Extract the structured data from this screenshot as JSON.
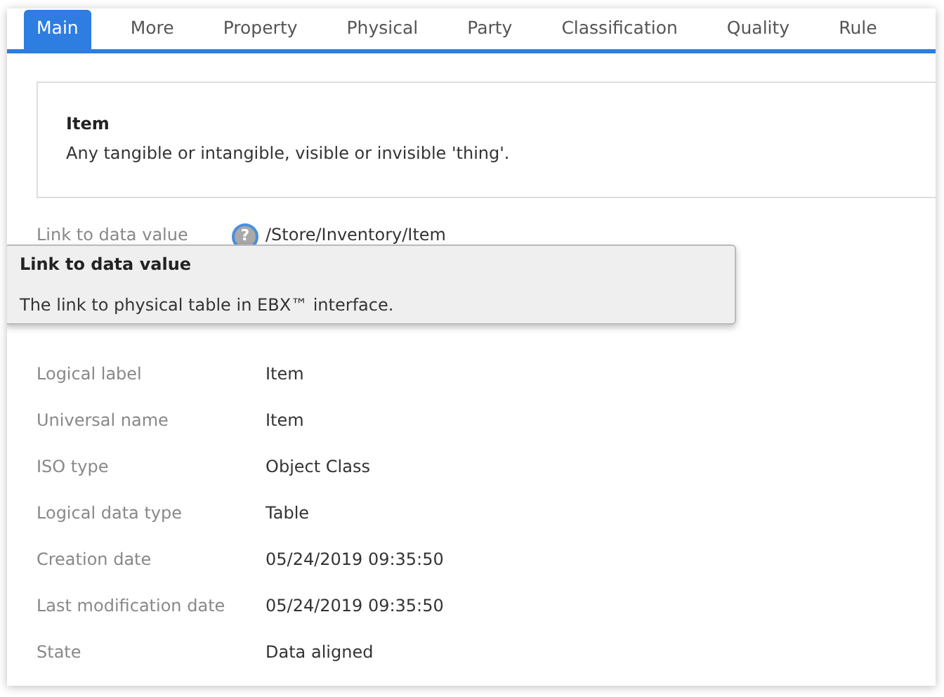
{
  "tabs": [
    {
      "label": "Main",
      "selected": true
    },
    {
      "label": "More",
      "selected": false
    },
    {
      "label": "Property",
      "selected": false
    },
    {
      "label": "Physical",
      "selected": false
    },
    {
      "label": "Party",
      "selected": false
    },
    {
      "label": "Classification",
      "selected": false
    },
    {
      "label": "Quality",
      "selected": false
    },
    {
      "label": "Rule",
      "selected": false
    }
  ],
  "summary": {
    "title": "Item",
    "description": "Any tangible or intangible, visible or invisible 'thing'."
  },
  "fields": [
    {
      "label": "Link to data value",
      "value": "/Store/Inventory/Item",
      "help": "?"
    },
    {
      "label": "Logical label",
      "value": "Item"
    },
    {
      "label": "Universal name",
      "value": "Item"
    },
    {
      "label": "ISO type",
      "value": "Object Class"
    },
    {
      "label": "Logical data type",
      "value": "Table"
    },
    {
      "label": "Creation date",
      "value": "05/24/2019 09:35:50"
    },
    {
      "label": "Last modification date",
      "value": "05/24/2019 09:35:50"
    },
    {
      "label": "State",
      "value": "Data aligned"
    }
  ],
  "tooltip": {
    "title": "Link to data value",
    "text": "The link to physical table in EBX™ interface."
  }
}
